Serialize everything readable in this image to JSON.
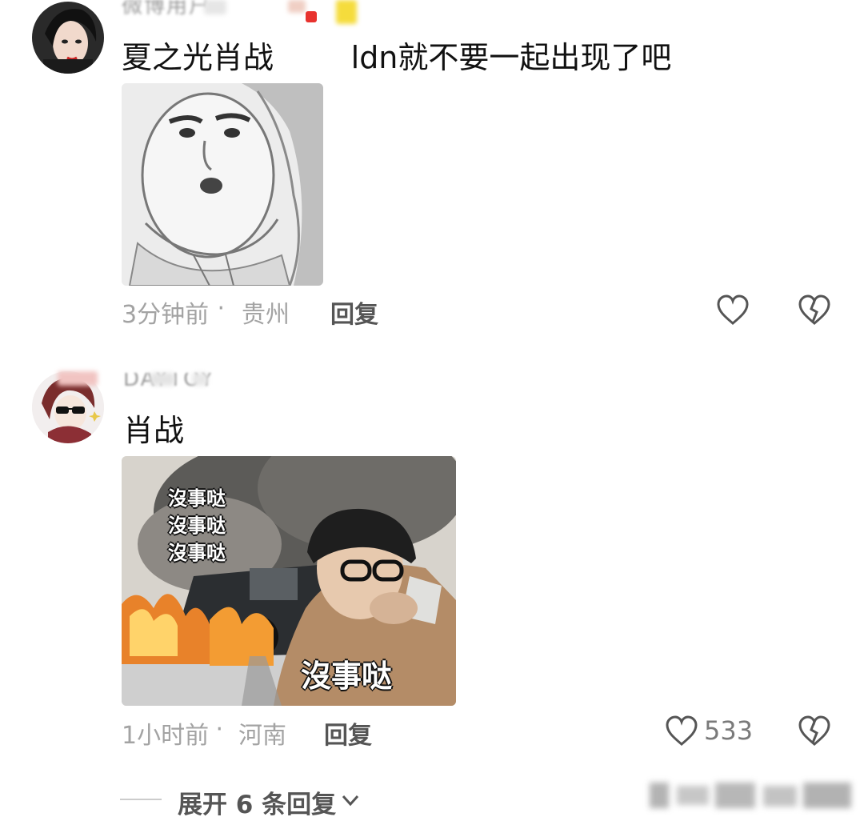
{
  "comments": [
    {
      "username": "微博用户",
      "text": "夏之光肖战        ldn就不要一起出现了吧",
      "time": "3分钟前",
      "location": "贵州",
      "reply_label": "回复",
      "like_count": ""
    },
    {
      "username": "DAYTOY",
      "text": "肖战",
      "sticker_caption_small": [
        "沒事哒",
        "沒事哒",
        "沒事哒"
      ],
      "sticker_caption_large": "沒事哒",
      "time": "1小时前",
      "location": "河南",
      "reply_label": "回复",
      "like_count": "533"
    }
  ],
  "expand_replies": {
    "label": "展开 6 条回复"
  },
  "meta_separator": " · ",
  "icons": {
    "like": "heart-outline-icon",
    "dislike": "broken-heart-icon",
    "expand": "chevron-down-icon"
  },
  "colors": {
    "text_primary": "#111111",
    "text_secondary": "#a3a3a3",
    "reply": "#555555",
    "icon": "#555555"
  }
}
